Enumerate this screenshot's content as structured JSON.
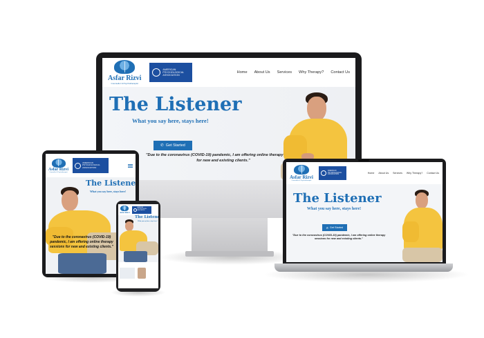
{
  "site": {
    "logo_name": "Asfar Rizvi",
    "logo_sub": "Counsellor & Psychotherapist",
    "apa_text": "American Psychological Association",
    "nav": [
      "Home",
      "About Us",
      "Services",
      "Why Therapy?",
      "Contact Us"
    ],
    "hero_title": "The Listener",
    "hero_subtitle": "What you say here, stays here!",
    "cta_label": "Get Started",
    "quote": "\"Due to the coronavirus (COVID-19) pandemic, I am offering online therapy sessions for new and existing clients.\""
  },
  "icons": {
    "brain_logo": "brain-icon",
    "apa_seal": "apa-seal-icon",
    "cta": "phone-icon",
    "menu": "hamburger-icon"
  },
  "colors": {
    "brand_blue": "#1f6fb5",
    "apa_blue": "#1c4fa0",
    "shirt_yellow": "#f4c43f",
    "bezel": "#1b1b1d"
  }
}
